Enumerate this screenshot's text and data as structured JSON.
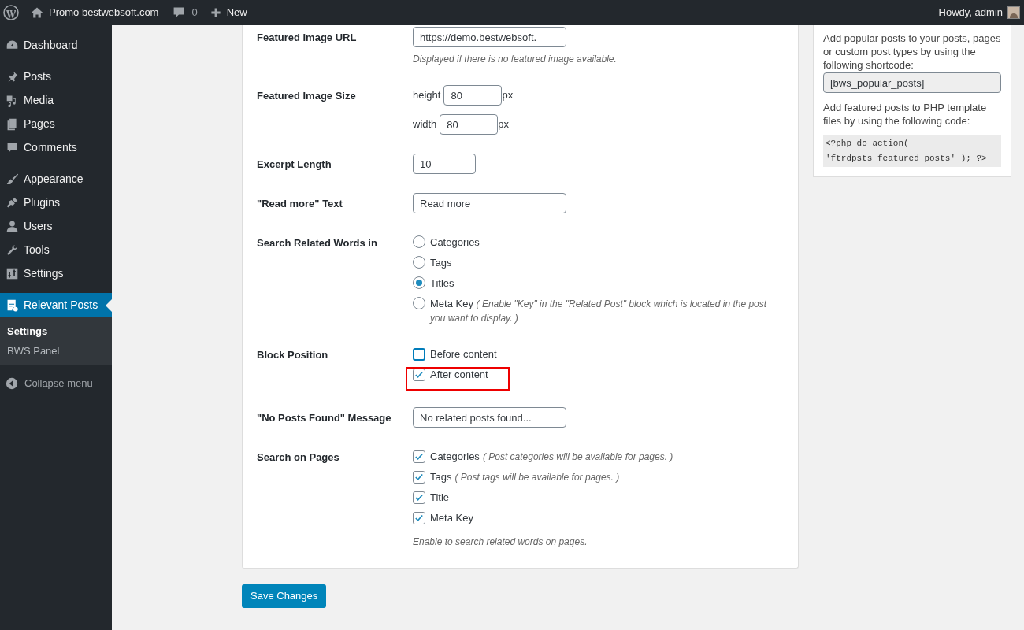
{
  "admin_bar": {
    "site_name": "Promo bestwebsoft.com",
    "comments_count": "0",
    "new_label": "New",
    "greeting": "Howdy, admin"
  },
  "sidebar": {
    "groups": [
      [
        {
          "label": "Dashboard",
          "selected": false
        }
      ],
      [
        {
          "label": "Posts",
          "selected": false
        },
        {
          "label": "Media",
          "selected": false
        },
        {
          "label": "Pages",
          "selected": false
        },
        {
          "label": "Comments",
          "selected": false
        }
      ],
      [
        {
          "label": "Appearance",
          "selected": false
        },
        {
          "label": "Plugins",
          "selected": false
        },
        {
          "label": "Users",
          "selected": false
        },
        {
          "label": "Tools",
          "selected": false
        },
        {
          "label": "Settings",
          "selected": false
        }
      ],
      [
        {
          "label": "Relevant Posts",
          "selected": true,
          "submenu": [
            {
              "label": "Settings",
              "selected": true
            },
            {
              "label": "BWS Panel",
              "selected": false
            }
          ]
        }
      ]
    ],
    "collapse_label": "Collapse menu"
  },
  "settings": [
    {
      "kind": "text",
      "label": "Featured Image URL",
      "value": "https://demo.bestwebsoft.",
      "hint": "Displayed if there is no featured image available."
    },
    {
      "kind": "size",
      "label": "Featured Image Size",
      "fields": [
        {
          "prefix": "height",
          "value": "80",
          "unit": "px"
        },
        {
          "prefix": "width",
          "value": "80",
          "unit": "px"
        }
      ]
    },
    {
      "kind": "number",
      "label": "Excerpt Length",
      "value": "10"
    },
    {
      "kind": "text",
      "label": "\"Read more\" Text",
      "value": "Read more"
    },
    {
      "kind": "radios",
      "label": "Search Related Words in",
      "options": [
        {
          "label": "Categories",
          "selected": false
        },
        {
          "label": "Tags",
          "selected": false
        },
        {
          "label": "Titles",
          "selected": true
        },
        {
          "label": "Meta Key",
          "note": "( Enable \"Key\" in the \"Related Post\" block which is located in the post you want to display. )",
          "selected": false
        }
      ]
    },
    {
      "kind": "checkboxes",
      "label": "Block Position",
      "options": [
        {
          "label": "Before content",
          "checked": false,
          "focused": true,
          "highlighted": false
        },
        {
          "label": "After content",
          "checked": true,
          "focused": false,
          "highlighted": true
        }
      ]
    },
    {
      "kind": "text",
      "label": "\"No Posts Found\" Message",
      "value": "No related posts found..."
    },
    {
      "kind": "checkboxes",
      "label": "Search on Pages",
      "options": [
        {
          "label": "Categories",
          "note": "( Post categories will be available for pages. )",
          "checked": true
        },
        {
          "label": "Tags",
          "note": "( Post tags will be available for pages. )",
          "checked": true
        },
        {
          "label": "Title",
          "checked": true
        },
        {
          "label": "Meta Key",
          "checked": true
        }
      ],
      "hint": "Enable to search related words on pages."
    }
  ],
  "save_button": "Save Changes",
  "side_panel": {
    "intro": "Add popular posts to your posts, pages or custom post types by using the following shortcode:",
    "shortcode": "[bws_popular_posts]",
    "php_intro": "Add featured posts to PHP template files by using the following code:",
    "php_code": "<?php do_action( 'ftrdpsts_featured_posts' ); ?>"
  }
}
